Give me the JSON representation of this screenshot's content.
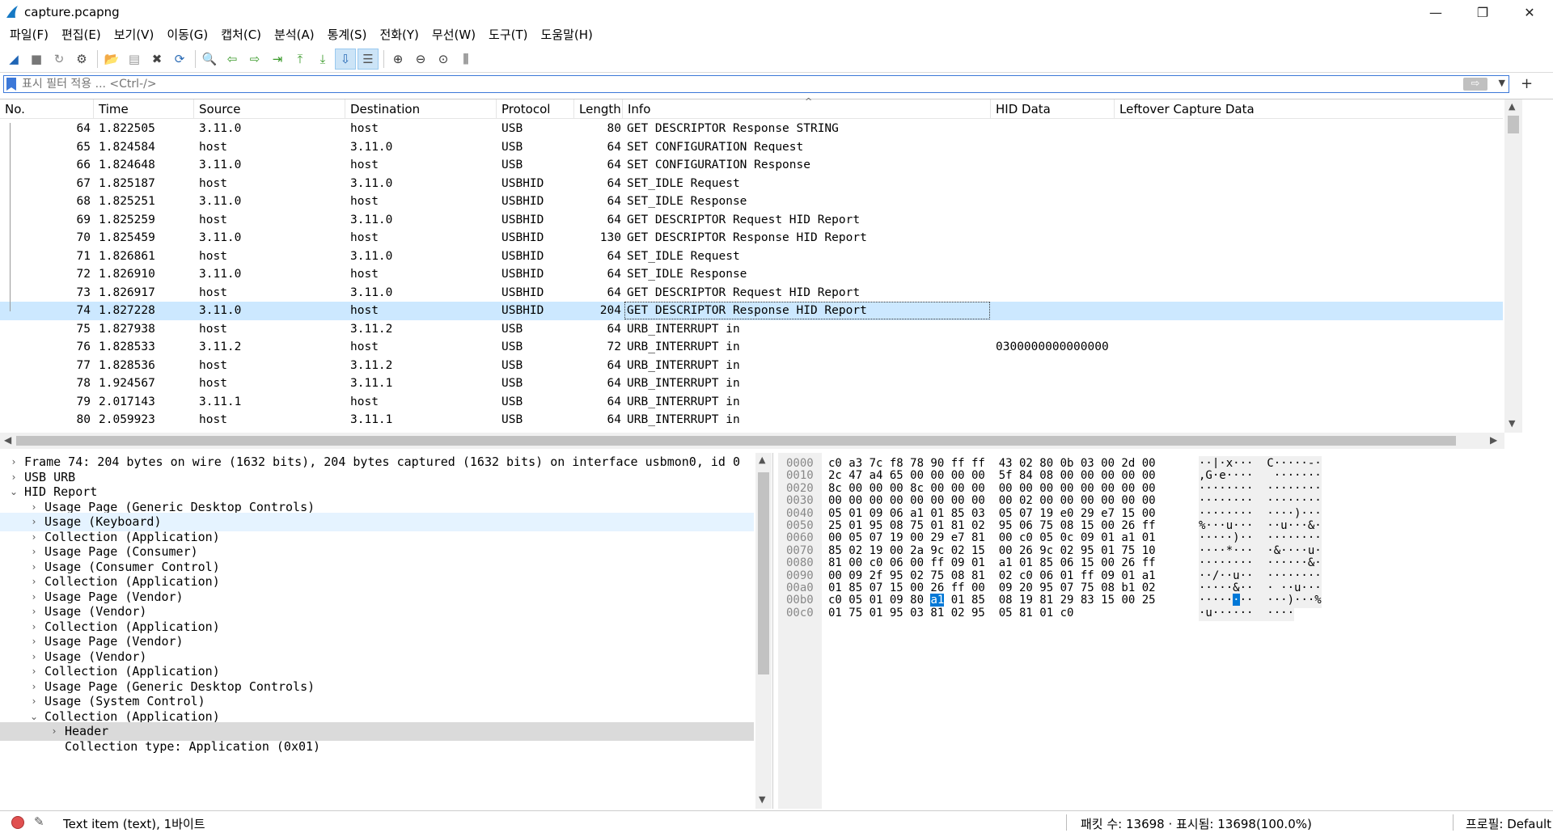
{
  "window": {
    "title": "capture.pcapng",
    "minimize": "—",
    "restore": "❐",
    "close": "✕"
  },
  "menu": [
    "파일(F)",
    "편집(E)",
    "보기(V)",
    "이동(G)",
    "캡처(C)",
    "분석(A)",
    "통계(S)",
    "전화(Y)",
    "무선(W)",
    "도구(T)",
    "도움말(H)"
  ],
  "toolbar": [
    "shark-start-icon",
    "stop-icon",
    "restart-icon",
    "options-icon",
    "sep",
    "open-icon",
    "save-icon",
    "close-file-icon",
    "reload-icon",
    "sep",
    "find-icon",
    "back-icon",
    "forward-icon",
    "goto-packet-icon",
    "first-packet-icon",
    "last-packet-icon",
    "autoscroll-icon",
    "colorize-icon",
    "sep",
    "zoom-in-icon",
    "zoom-out-icon",
    "zoom-reset-icon",
    "resize-columns-icon"
  ],
  "filter": {
    "placeholder": "표시 필터 적용 ... <Ctrl-/>",
    "apply": "⇨",
    "add": "+"
  },
  "columns": {
    "no": "No.",
    "time": "Time",
    "source": "Source",
    "destination": "Destination",
    "protocol": "Protocol",
    "length": "Length",
    "info": "Info",
    "hid": "HID Data",
    "leftover": "Leftover Capture Data"
  },
  "packets": [
    {
      "no": "64",
      "time": "1.822505",
      "src": "3.11.0",
      "dst": "host",
      "proto": "USB",
      "len": "80",
      "info": "GET DESCRIPTOR Response STRING",
      "hid": ""
    },
    {
      "no": "65",
      "time": "1.824584",
      "src": "host",
      "dst": "3.11.0",
      "proto": "USB",
      "len": "64",
      "info": "SET CONFIGURATION Request",
      "hid": ""
    },
    {
      "no": "66",
      "time": "1.824648",
      "src": "3.11.0",
      "dst": "host",
      "proto": "USB",
      "len": "64",
      "info": "SET CONFIGURATION Response",
      "hid": ""
    },
    {
      "no": "67",
      "time": "1.825187",
      "src": "host",
      "dst": "3.11.0",
      "proto": "USBHID",
      "len": "64",
      "info": "SET_IDLE Request",
      "hid": ""
    },
    {
      "no": "68",
      "time": "1.825251",
      "src": "3.11.0",
      "dst": "host",
      "proto": "USBHID",
      "len": "64",
      "info": "SET_IDLE Response",
      "hid": ""
    },
    {
      "no": "69",
      "time": "1.825259",
      "src": "host",
      "dst": "3.11.0",
      "proto": "USBHID",
      "len": "64",
      "info": "GET DESCRIPTOR Request HID Report",
      "hid": ""
    },
    {
      "no": "70",
      "time": "1.825459",
      "src": "3.11.0",
      "dst": "host",
      "proto": "USBHID",
      "len": "130",
      "info": "GET DESCRIPTOR Response HID Report",
      "hid": ""
    },
    {
      "no": "71",
      "time": "1.826861",
      "src": "host",
      "dst": "3.11.0",
      "proto": "USBHID",
      "len": "64",
      "info": "SET_IDLE Request",
      "hid": ""
    },
    {
      "no": "72",
      "time": "1.826910",
      "src": "3.11.0",
      "dst": "host",
      "proto": "USBHID",
      "len": "64",
      "info": "SET_IDLE Response",
      "hid": ""
    },
    {
      "no": "73",
      "time": "1.826917",
      "src": "host",
      "dst": "3.11.0",
      "proto": "USBHID",
      "len": "64",
      "info": "GET DESCRIPTOR Request HID Report",
      "hid": ""
    },
    {
      "no": "74",
      "time": "1.827228",
      "src": "3.11.0",
      "dst": "host",
      "proto": "USBHID",
      "len": "204",
      "info": "GET DESCRIPTOR Response HID Report",
      "hid": ""
    },
    {
      "no": "75",
      "time": "1.827938",
      "src": "host",
      "dst": "3.11.2",
      "proto": "USB",
      "len": "64",
      "info": "URB_INTERRUPT in",
      "hid": ""
    },
    {
      "no": "76",
      "time": "1.828533",
      "src": "3.11.2",
      "dst": "host",
      "proto": "USB",
      "len": "72",
      "info": "URB_INTERRUPT in",
      "hid": "0300000000000000"
    },
    {
      "no": "77",
      "time": "1.828536",
      "src": "host",
      "dst": "3.11.2",
      "proto": "USB",
      "len": "64",
      "info": "URB_INTERRUPT in",
      "hid": ""
    },
    {
      "no": "78",
      "time": "1.924567",
      "src": "host",
      "dst": "3.11.1",
      "proto": "USB",
      "len": "64",
      "info": "URB_INTERRUPT in",
      "hid": ""
    },
    {
      "no": "79",
      "time": "2.017143",
      "src": "3.11.1",
      "dst": "host",
      "proto": "USB",
      "len": "64",
      "info": "URB_INTERRUPT in",
      "hid": ""
    },
    {
      "no": "80",
      "time": "2.059923",
      "src": "host",
      "dst": "3.11.1",
      "proto": "USB",
      "len": "64",
      "info": "URB_INTERRUPT in",
      "hid": ""
    }
  ],
  "selected_packet": "74",
  "details": [
    {
      "level": 0,
      "state": "collapsed",
      "text": "Frame 74: 204 bytes on wire (1632 bits), 204 bytes captured (1632 bits) on interface usbmon0, id 0"
    },
    {
      "level": 0,
      "state": "collapsed",
      "text": "USB URB"
    },
    {
      "level": 0,
      "state": "expanded",
      "text": "HID Report"
    },
    {
      "level": 1,
      "state": "collapsed",
      "text": "Usage Page (Generic Desktop Controls)"
    },
    {
      "level": 1,
      "state": "collapsed",
      "text": "Usage (Keyboard)",
      "hl": true
    },
    {
      "level": 1,
      "state": "collapsed",
      "text": "Collection (Application)"
    },
    {
      "level": 1,
      "state": "collapsed",
      "text": "Usage Page (Consumer)"
    },
    {
      "level": 1,
      "state": "collapsed",
      "text": "Usage (Consumer Control)"
    },
    {
      "level": 1,
      "state": "collapsed",
      "text": "Collection (Application)"
    },
    {
      "level": 1,
      "state": "collapsed",
      "text": "Usage Page (Vendor)"
    },
    {
      "level": 1,
      "state": "collapsed",
      "text": "Usage (Vendor)"
    },
    {
      "level": 1,
      "state": "collapsed",
      "text": "Collection (Application)"
    },
    {
      "level": 1,
      "state": "collapsed",
      "text": "Usage Page (Vendor)"
    },
    {
      "level": 1,
      "state": "collapsed",
      "text": "Usage (Vendor)"
    },
    {
      "level": 1,
      "state": "collapsed",
      "text": "Collection (Application)"
    },
    {
      "level": 1,
      "state": "collapsed",
      "text": "Usage Page (Generic Desktop Controls)"
    },
    {
      "level": 1,
      "state": "collapsed",
      "text": "Usage (System Control)"
    },
    {
      "level": 1,
      "state": "expanded",
      "text": "Collection (Application)"
    },
    {
      "level": 2,
      "state": "collapsed",
      "text": "Header",
      "sel": true
    },
    {
      "level": 2,
      "state": "none",
      "text": "Collection type: Application (0x01)"
    }
  ],
  "bytes": [
    {
      "off": "0000",
      "hex": "c0 a3 7c f8 78 90 ff ff  43 02 80 0b 03 00 2d 00",
      "asc": "··|·x···  C·····-·"
    },
    {
      "off": "0010",
      "hex": "2c 47 a4 65 00 00 00 00  5f 84 08 00 00 00 00 00",
      "asc": ",G·e····  _·······"
    },
    {
      "off": "0020",
      "hex": "8c 00 00 00 8c 00 00 00  00 00 00 00 00 00 00 00",
      "asc": "········  ········"
    },
    {
      "off": "0030",
      "hex": "00 00 00 00 00 00 00 00  00 02 00 00 00 00 00 00",
      "asc": "········  ········"
    },
    {
      "off": "0040",
      "hex": "05 01 09 06 a1 01 85 03  05 07 19 e0 29 e7 15 00",
      "asc": "········  ····)···"
    },
    {
      "off": "0050",
      "hex": "25 01 95 08 75 01 81 02  95 06 75 08 15 00 26 ff",
      "asc": "%···u···  ··u···&·"
    },
    {
      "off": "0060",
      "hex": "00 05 07 19 00 29 e7 81  00 c0 05 0c 09 01 a1 01",
      "asc": "·····)··  ········"
    },
    {
      "off": "0070",
      "hex": "85 02 19 00 2a 9c 02 15  00 26 9c 02 95 01 75 10",
      "asc": "····*···  ·&····u·"
    },
    {
      "off": "0080",
      "hex": "81 00 c0 06 00 ff 09 01  a1 01 85 06 15 00 26 ff",
      "asc": "········  ······&·"
    },
    {
      "off": "0090",
      "hex": "00 09 2f 95 02 75 08 81  02 c0 06 01 ff 09 01 a1",
      "asc": "··/··u··  ········"
    },
    {
      "off": "00a0",
      "hex": "01 85 07 15 00 26 ff 00  09 20 95 07 75 08 b1 02",
      "asc": "·····&··  · ··u···"
    },
    {
      "off": "00b0",
      "hex": "c0 05 01 09 80 a1 01 85  08 19 81 29 83 15 00 25",
      "asc": "········  ···)···%"
    },
    {
      "off": "00c0",
      "hex": "01 75 01 95 03 81 02 95  05 81 01 c0",
      "asc": "·u······  ····"
    }
  ],
  "status": {
    "text_item": "Text item (text), 1바이트",
    "packets": "패킷 수: 13698 · 표시됨: 13698(100.0%)",
    "profile": "프로필: Default"
  }
}
